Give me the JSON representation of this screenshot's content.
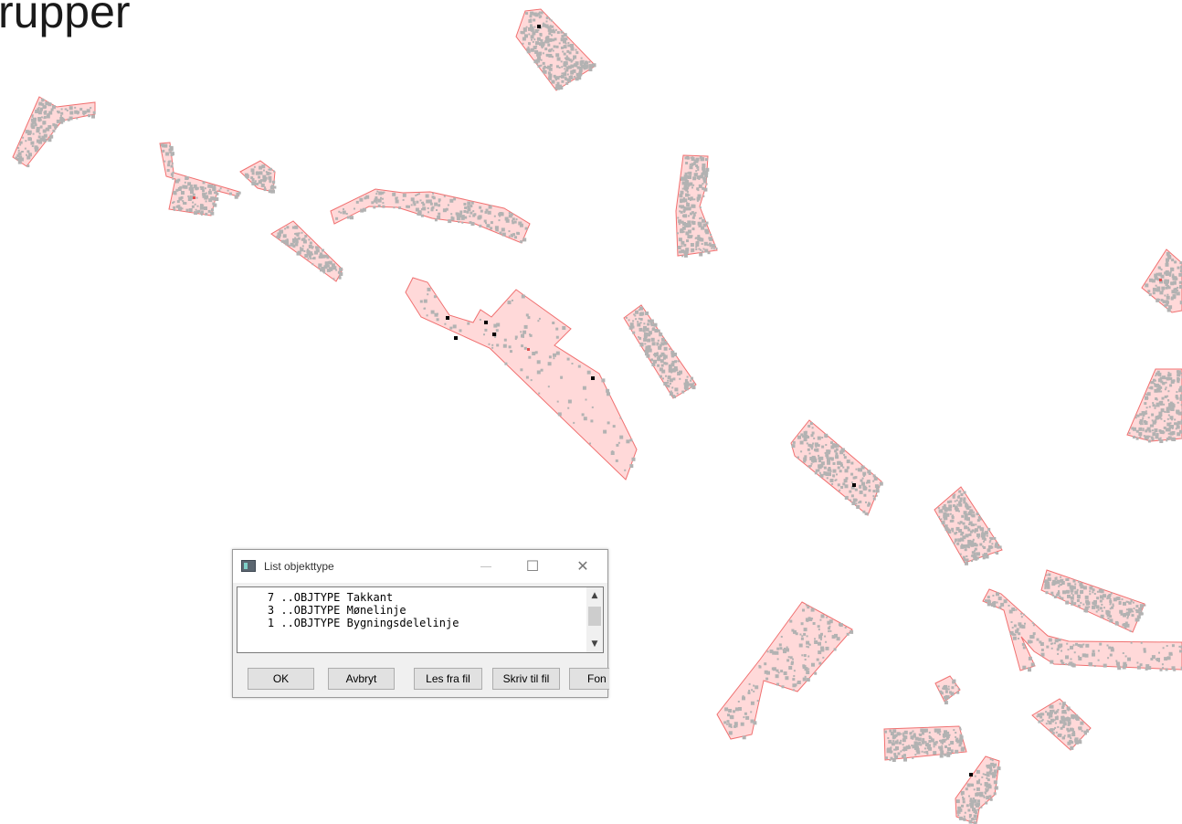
{
  "slide": {
    "title": "rupper"
  },
  "dialog": {
    "title": "List objekttype",
    "icons": {
      "app": "app-window-icon",
      "minimize": "minimize-icon",
      "maximize": "maximize-icon",
      "close": "close-icon"
    },
    "list": {
      "items": [
        "    7 ..OBJTYPE Takkant",
        "    3 ..OBJTYPE Mønelinje",
        "    1 ..OBJTYPE Bygningsdelelinje"
      ]
    },
    "buttons": {
      "ok": "OK",
      "cancel": "Avbryt",
      "read_file": "Les fra fil",
      "write_file": "Skriv til fil",
      "font": "Fon"
    }
  },
  "colors": {
    "polygon_fill": "#ffd9d9",
    "polygon_stroke": "#f07070",
    "points": "#b2b2b2"
  }
}
